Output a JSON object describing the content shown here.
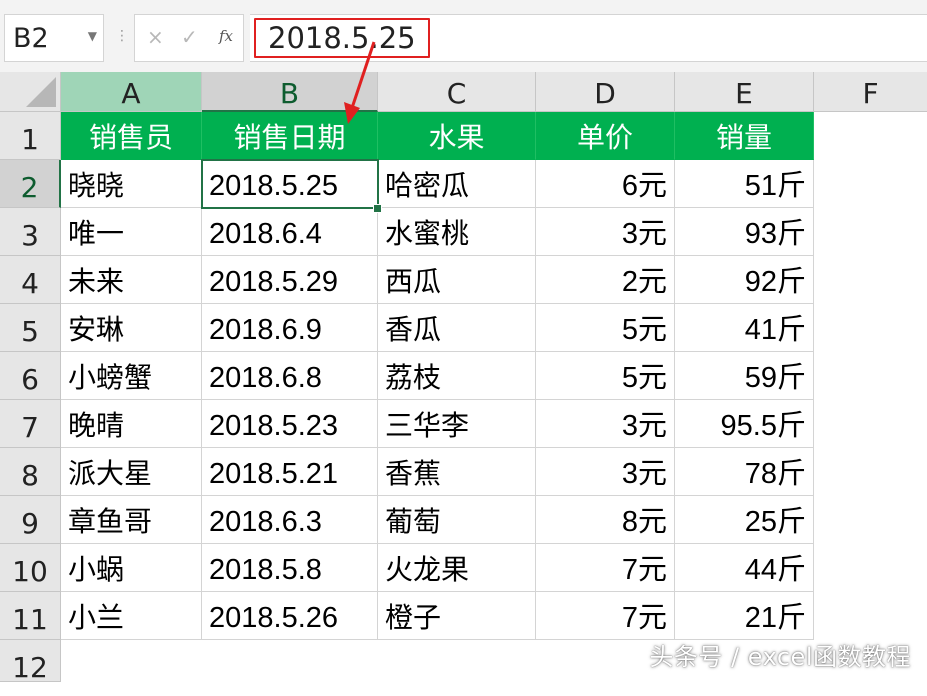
{
  "name_box": {
    "value": "B2"
  },
  "formula_bar": {
    "cancel_glyph": "×",
    "enter_glyph": "✓",
    "fx_label": "fx",
    "value": "2018.5.25"
  },
  "columns": [
    "A",
    "B",
    "C",
    "D",
    "E",
    "F"
  ],
  "rows": [
    "1",
    "2",
    "3",
    "4",
    "5",
    "6",
    "7",
    "8",
    "9",
    "10",
    "11",
    "12"
  ],
  "header_row": [
    "销售员",
    "销售日期",
    "水果",
    "单价",
    "销量"
  ],
  "data_rows": [
    [
      "晓晓",
      "2018.5.25",
      "哈密瓜",
      "6元",
      "51斤"
    ],
    [
      "唯一",
      "2018.6.4",
      "水蜜桃",
      "3元",
      "93斤"
    ],
    [
      "未来",
      "2018.5.29",
      "西瓜",
      "2元",
      "92斤"
    ],
    [
      "安琳",
      "2018.6.9",
      "香瓜",
      "5元",
      "41斤"
    ],
    [
      "小螃蟹",
      "2018.6.8",
      "荔枝",
      "5元",
      "59斤"
    ],
    [
      "晚晴",
      "2018.5.23",
      "三华李",
      "3元",
      "95.5斤"
    ],
    [
      "派大星",
      "2018.5.21",
      "香蕉",
      "3元",
      "78斤"
    ],
    [
      "章鱼哥",
      "2018.6.3",
      "葡萄",
      "8元",
      "25斤"
    ],
    [
      "小蜗",
      "2018.5.8",
      "火龙果",
      "7元",
      "44斤"
    ],
    [
      "小兰",
      "2018.5.26",
      "橙子",
      "7元",
      "21斤"
    ]
  ],
  "watermark": "头条号 / excel函数教程",
  "colors": {
    "header_fill": "#00b050",
    "selection": "#217346",
    "highlight_border": "#e02020"
  }
}
